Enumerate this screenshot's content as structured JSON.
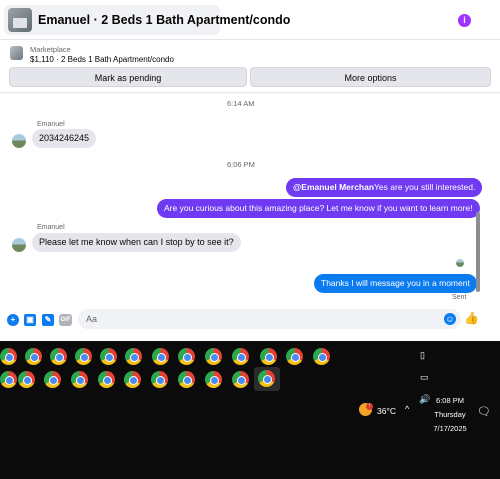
{
  "header": {
    "title": "Emanuel · 2 Beds 1 Bath Apartment/condo",
    "info_icon": "i"
  },
  "listing": {
    "source": "Marketplace",
    "text": "$1,110 · 2 Beds 1 Bath Apartment/condo",
    "mark_pending_label": "Mark as pending",
    "more_options_label": "More options"
  },
  "messages": {
    "time1": "6:14 AM",
    "sender1": "Emanuel",
    "msg1": "2034246245",
    "time2": "6:06 PM",
    "out1_mention": "@Emanuel Merchan",
    "out1_text": "Yes are you still interested.",
    "out2": "Are you curious about this amazing place? Let me know if you want to learn more!",
    "sender2": "Emanuel",
    "msg2": "Please let me know when can I stop by to see it?",
    "out3": "Thanks I will message you in a moment",
    "status": "Sent"
  },
  "composer": {
    "placeholder": "Aa",
    "gif_label": "GIF"
  },
  "taskbar": {
    "temperature": "36°C",
    "time": "6:08 PM",
    "day": "Thursday",
    "date": "7/17/2025"
  },
  "colors": {
    "accent_purple": "#6f3af2",
    "accent_blue": "#0b7bf0",
    "info_purple": "#a033ff"
  }
}
